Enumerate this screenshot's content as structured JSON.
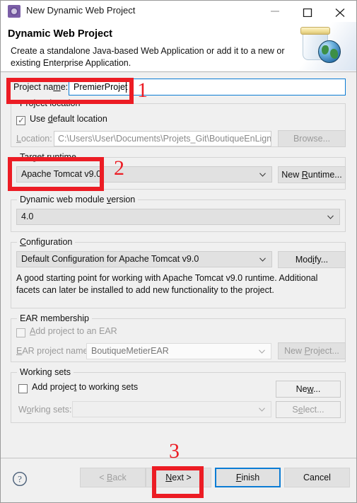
{
  "window": {
    "title": "New Dynamic Web Project",
    "icon": "wizard-gear-icon",
    "minimize_label": "Minimize",
    "maximize_label": "Maximize",
    "close_label": "Close"
  },
  "banner": {
    "title": "Dynamic Web Project",
    "description": "Create a standalone Java-based Web Application or add it to a new or existing Enterprise Application.",
    "art": "jar-and-globe-icon"
  },
  "form": {
    "project_name": {
      "label": "Project name:",
      "value": "PremierProjet",
      "placeholder": ""
    },
    "project_location": {
      "legend": "Project location",
      "use_default_label": "Use default location",
      "use_default_checked": true,
      "location_label": "Location:",
      "location_value": "C:\\Users\\User\\Documents\\Projets_Git\\BoutiqueEnLigne\\P",
      "browse_label": "Browse..."
    },
    "target_runtime": {
      "legend": "Target runtime",
      "value": "Apache Tomcat v9.0",
      "new_runtime_label": "New Runtime..."
    },
    "module_version": {
      "legend": "Dynamic web module version",
      "value": "4.0"
    },
    "configuration": {
      "legend": "Configuration",
      "value": "Default Configuration for Apache Tomcat v9.0",
      "modify_label": "Modify...",
      "description": "A good starting point for working with Apache Tomcat v9.0 runtime. Additional facets can later be installed to add new functionality to the project."
    },
    "ear_membership": {
      "legend": "EAR membership",
      "add_to_ear_label": "Add project to an EAR",
      "add_to_ear_checked": false,
      "ear_project_label": "EAR project name:",
      "ear_project_value": "BoutiqueMetierEAR",
      "new_project_label": "New Project..."
    },
    "working_sets": {
      "legend": "Working sets",
      "add_to_sets_label": "Add project to working sets",
      "add_to_sets_checked": false,
      "working_sets_label": "Working sets:",
      "working_sets_value": "",
      "new_label": "New...",
      "select_label": "Select..."
    }
  },
  "footer": {
    "help_icon": "question-mark-icon",
    "back_label": "< Back",
    "next_label": "Next >",
    "finish_label": "Finish",
    "cancel_label": "Cancel"
  },
  "annotations": {
    "accent_color": "#ec1c24",
    "step1": "1",
    "step2": "2",
    "step3": "3"
  }
}
